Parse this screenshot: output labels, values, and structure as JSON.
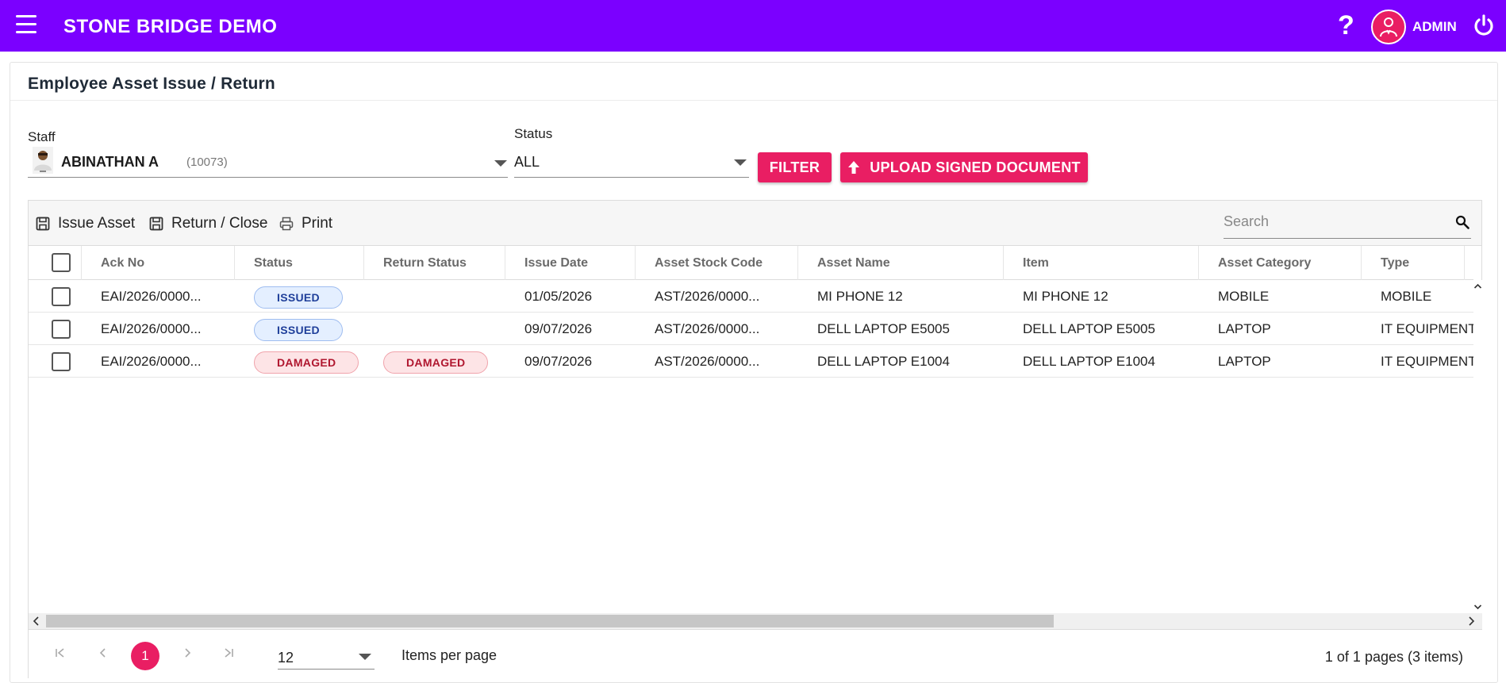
{
  "app": {
    "title": "STONE BRIDGE DEMO",
    "help_icon": "?",
    "user": "ADMIN",
    "brand_color": "#7b00ff",
    "accent_color": "#e91e63"
  },
  "page": {
    "title": "Employee Asset Issue / Return"
  },
  "filters": {
    "staff_label": "Staff",
    "staff_name": "ABINATHAN A",
    "staff_code": "(10073)",
    "status_label": "Status",
    "status_value": "ALL",
    "filter_button": "FILTER",
    "upload_button": "UPLOAD SIGNED DOCUMENT"
  },
  "toolbar": {
    "issue_label": "Issue Asset",
    "return_label": "Return / Close",
    "print_label": "Print",
    "search_placeholder": "Search"
  },
  "table": {
    "columns": [
      "Ack No",
      "Status",
      "Return Status",
      "Issue Date",
      "Asset Stock Code",
      "Asset Name",
      "Item",
      "Asset Category",
      "Type"
    ],
    "rows": [
      {
        "ack_no": "EAI/2026/0000...",
        "status": "ISSUED",
        "return_status": "",
        "issue_date": "01/05/2026",
        "stock_code": "AST/2026/0000...",
        "asset_name": "MI PHONE 12",
        "item": "MI PHONE 12",
        "category": "MOBILE",
        "type": "MOBILE"
      },
      {
        "ack_no": "EAI/2026/0000...",
        "status": "ISSUED",
        "return_status": "",
        "issue_date": "09/07/2026",
        "stock_code": "AST/2026/0000...",
        "asset_name": "DELL LAPTOP E5005",
        "item": "DELL LAPTOP E5005",
        "category": "LAPTOP",
        "type": "IT EQUIPMENT"
      },
      {
        "ack_no": "EAI/2026/0000...",
        "status": "DAMAGED",
        "return_status": "DAMAGED",
        "issue_date": "09/07/2026",
        "stock_code": "AST/2026/0000...",
        "asset_name": "DELL LAPTOP E1004",
        "item": "DELL LAPTOP E1004",
        "category": "LAPTOP",
        "type": "IT EQUIPMENT"
      }
    ]
  },
  "pager": {
    "current_page": "1",
    "page_size": "12",
    "items_per_page_label": "Items per page",
    "info": "1 of 1 pages (3 items)"
  }
}
